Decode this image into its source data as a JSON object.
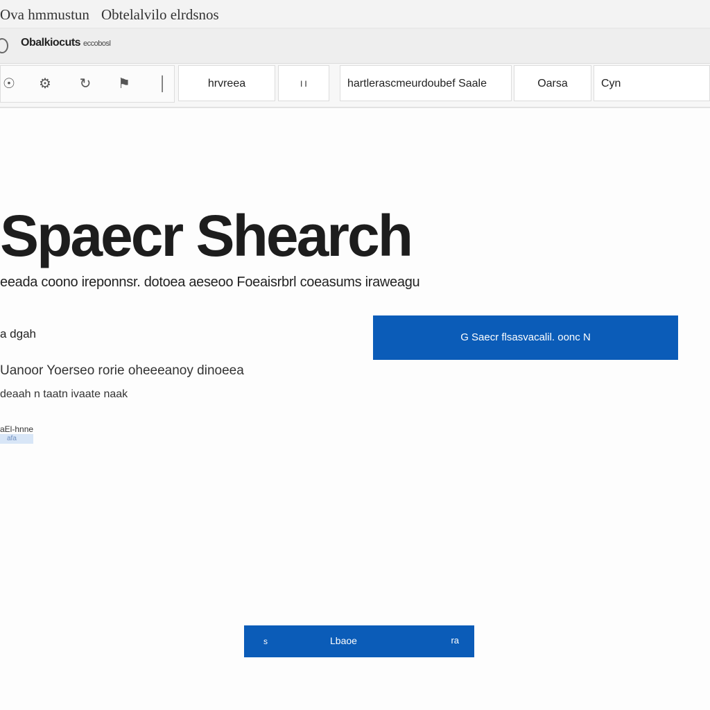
{
  "window": {
    "title_left": "Ova hmmustun",
    "title_right": "Obtelalvilo elrdsnos"
  },
  "address_bar": {
    "text": "Obalkiocuts",
    "suffix": "eccobosl"
  },
  "toolbar": {
    "icons": [
      "globe-icon",
      "gear-icon",
      "refresh-icon",
      "bookmark-icon",
      "more-icon"
    ],
    "tab1": "hrvreea",
    "tab2_line": "l I",
    "tab3": "hartlerascmeurdoubef Saale",
    "tab4": "Oarsa",
    "tab5": "Cyn"
  },
  "main": {
    "title": "Spaecr Shearch",
    "subtitle": "eeada coono ireponnsr. dotoea aeseoo Foeaisrbrl coeasums iraweagu",
    "label": "a dgah",
    "primary_button": "G    Saecr flsasvacalil. oonc  N",
    "desc_line1": "Uanoor Yoerseo rorie oheeeanoy dinoeea",
    "desc_line2": "deaah n taatn ivaate naak",
    "tag_label": "aEl-hnne",
    "tag_chip": "afa",
    "bottom_bar": {
      "left": "s",
      "label": "Lbaoe",
      "right": "ra"
    }
  },
  "colors": {
    "accent": "#0b5cb8",
    "background": "#fdfdfd"
  }
}
